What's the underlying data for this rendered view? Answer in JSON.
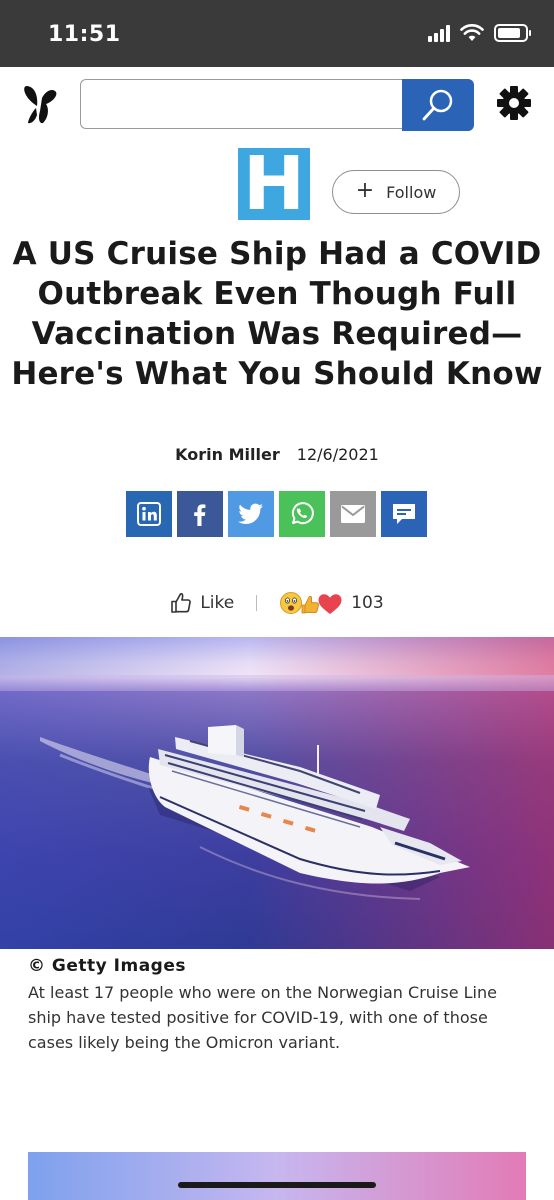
{
  "status_bar": {
    "time": "11:51"
  },
  "search": {
    "value": "",
    "placeholder": ""
  },
  "publisher": {
    "logo_letter": "H",
    "follow_label": "Follow"
  },
  "article": {
    "title": "A US Cruise Ship Had a COVID Outbreak Even Though Full Vaccination Was Required—Here's What You Should Know",
    "author": "Korin Miller",
    "date": "12/6/2021"
  },
  "share": {
    "buttons": [
      {
        "name": "linkedin",
        "color": "#2867b2"
      },
      {
        "name": "facebook",
        "color": "#3b5998"
      },
      {
        "name": "twitter",
        "color": "#4f9ae3"
      },
      {
        "name": "whatsapp",
        "color": "#4ac259"
      },
      {
        "name": "email",
        "color": "#9a9a9a"
      },
      {
        "name": "comment",
        "color": "#2b63b6"
      }
    ]
  },
  "reactions": {
    "like_label": "Like",
    "count": "103"
  },
  "image": {
    "credit": "© Getty Images",
    "caption": "At least 17 people who were on the Norwegian Cruise Line ship have tested positive for COVID-19, with one of those cases likely being the Omicron variant."
  },
  "colors": {
    "accent": "#2b63b6",
    "publisher_logo": "#3fa7df"
  }
}
